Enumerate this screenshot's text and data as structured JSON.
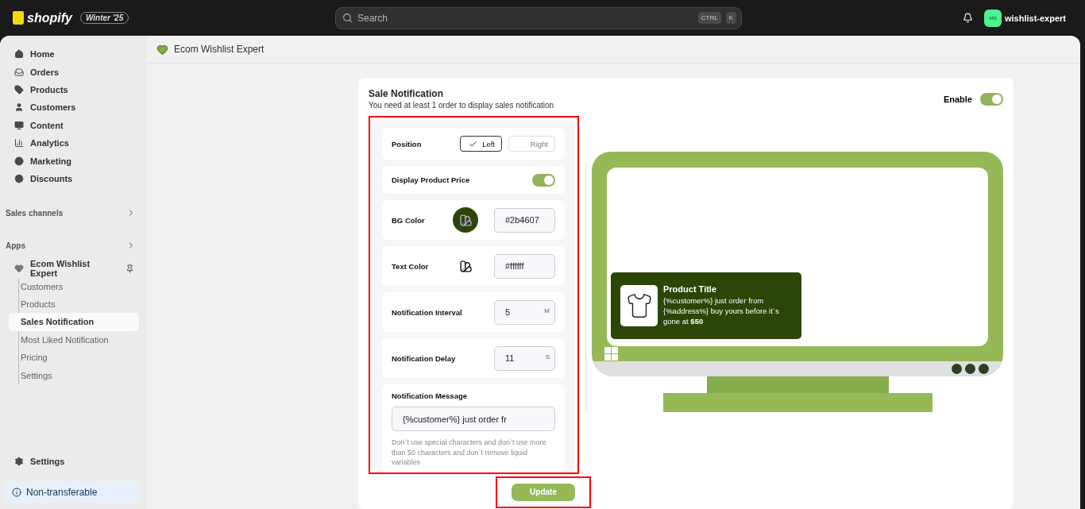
{
  "topbar": {
    "brand": "shopify",
    "edition": "Winter '25",
    "search": {
      "placeholder": "Search"
    },
    "shortcut_keys": [
      "CTRL",
      "K"
    ],
    "store": {
      "initials": "wis",
      "name": "wishlist-expert"
    }
  },
  "sidebar": {
    "items": [
      {
        "label": "Home"
      },
      {
        "label": "Orders"
      },
      {
        "label": "Products"
      },
      {
        "label": "Customers"
      },
      {
        "label": "Content"
      },
      {
        "label": "Analytics"
      },
      {
        "label": "Marketing"
      },
      {
        "label": "Discounts"
      }
    ],
    "sections": [
      {
        "label": "Sales channels"
      },
      {
        "label": "Apps"
      }
    ],
    "app": {
      "label": "Ecom Wishlist Expert",
      "children": [
        {
          "label": "Customers",
          "selected": false
        },
        {
          "label": "Products",
          "selected": false
        },
        {
          "label": "Sales Notification",
          "selected": true
        },
        {
          "label": "Most Liked Notification",
          "selected": false
        },
        {
          "label": "Pricing",
          "selected": false
        },
        {
          "label": "Settings",
          "selected": false
        }
      ]
    },
    "footer_item": {
      "label": "Settings"
    },
    "notice": "Non-transferable"
  },
  "page_header": {
    "title": "Ecom Wishlist Expert"
  },
  "card": {
    "title": "Sale Notification",
    "subtitle": "You need at least 1 order to display sales notification",
    "enable": {
      "label": "Enable",
      "on": true
    }
  },
  "settings": [
    {
      "kind": "segmented",
      "label": "Position",
      "options": [
        {
          "label": "Left",
          "selected": true
        },
        {
          "label": "Right",
          "selected": false
        }
      ]
    },
    {
      "kind": "toggle",
      "label": "Display Product Price",
      "on": true
    },
    {
      "kind": "color",
      "label": "BG Color",
      "value": "#2b4607",
      "color": "#2b4607"
    },
    {
      "kind": "color",
      "label": "Text Color",
      "value": "#ffffff",
      "color": "#ffffff"
    },
    {
      "kind": "number",
      "label": "Notification Interval",
      "value": "5",
      "unit": "M"
    },
    {
      "kind": "number",
      "label": "Notification Delay",
      "value": "11",
      "unit": "S"
    },
    {
      "kind": "message",
      "label": "Notification Message",
      "value": "{%customer%} just order fr",
      "help": "Don`t use special characters and don`t use more than 50 characters and don`t remove liquid variables"
    }
  ],
  "update_button": "Update",
  "preview": {
    "title": "Product Title",
    "message": "{%customer%} just order from {%address%} buy yours before it`s gone at **$50**"
  }
}
